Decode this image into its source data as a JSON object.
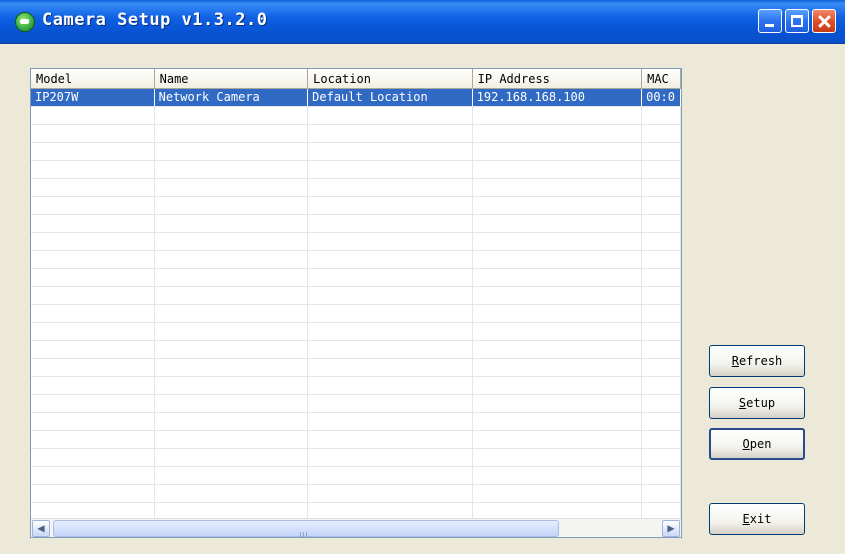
{
  "window": {
    "title": "Camera Setup v1.3.2.0"
  },
  "listview": {
    "columns": [
      "Model",
      "Name",
      "Location",
      "IP Address",
      "MAC"
    ],
    "rows": [
      [
        "IP207W",
        "Network Camera",
        "Default Location",
        "192.168.168.100",
        "00:0"
      ]
    ],
    "selected_row": 0
  },
  "buttons": {
    "refresh": {
      "mnemonic": "R",
      "rest": "efresh"
    },
    "setup": {
      "mnemonic": "S",
      "rest": "etup"
    },
    "open": {
      "mnemonic": "O",
      "rest": "pen"
    },
    "exit": {
      "mnemonic": "E",
      "rest": "xit"
    }
  },
  "colors": {
    "titlebar": "#0a5fd8",
    "selection": "#316ac5",
    "window_bg": "#ece9d8"
  }
}
